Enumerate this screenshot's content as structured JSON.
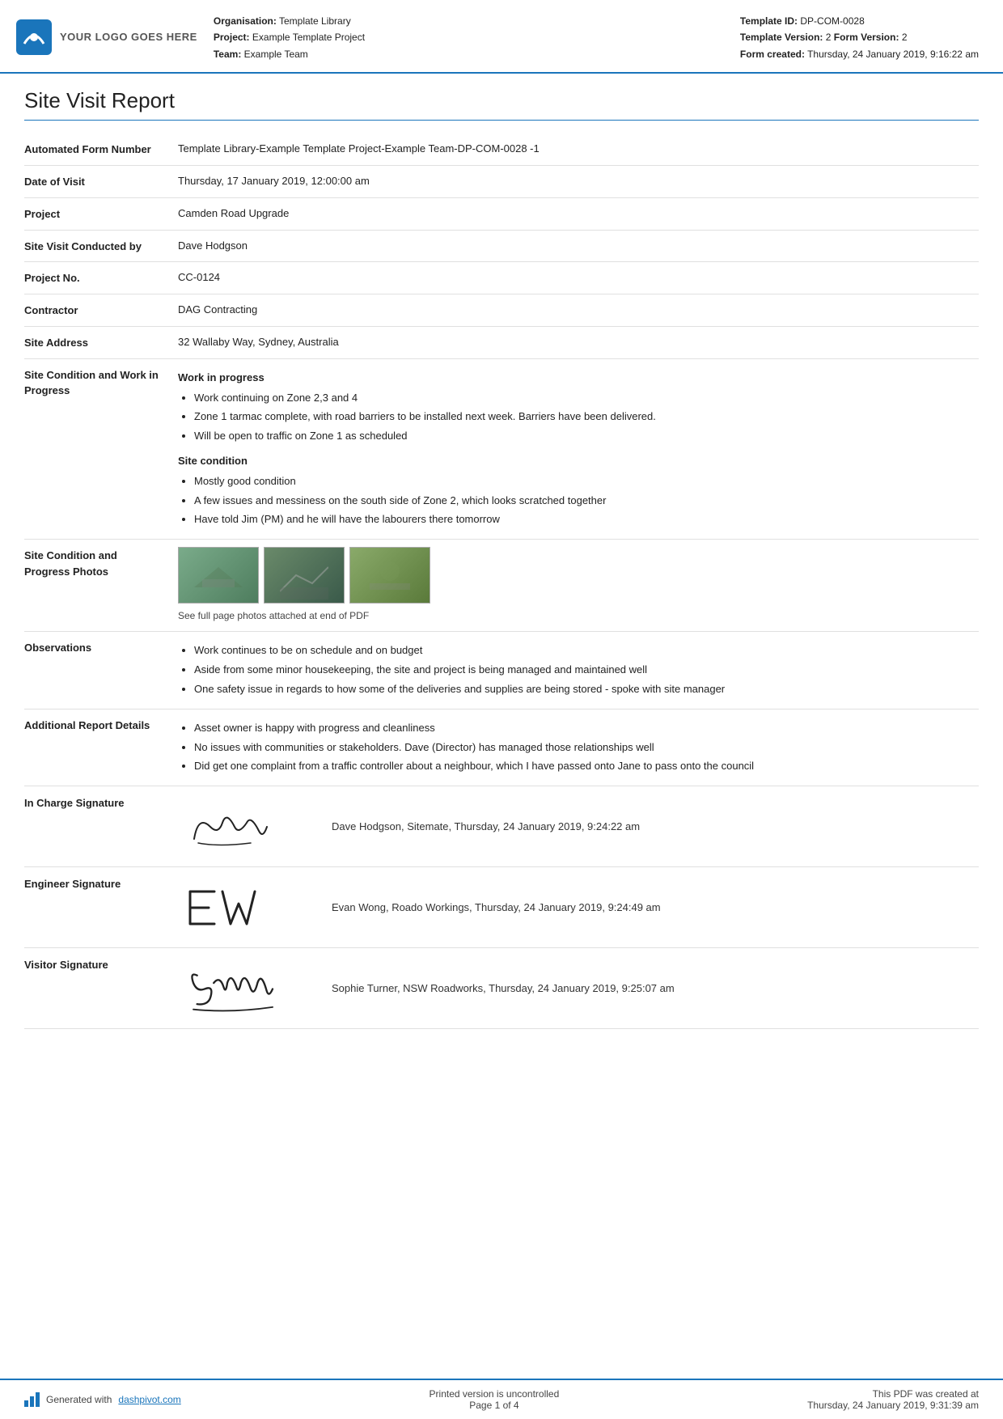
{
  "header": {
    "logo_text": "YOUR LOGO GOES HERE",
    "org_label": "Organisation:",
    "org_value": "Template Library",
    "project_label": "Project:",
    "project_value": "Example Template Project",
    "team_label": "Team:",
    "team_value": "Example Team",
    "template_id_label": "Template ID:",
    "template_id_value": "DP-COM-0028",
    "template_version_label": "Template Version:",
    "template_version_value": "2",
    "form_version_label": "Form Version:",
    "form_version_value": "2",
    "form_created_label": "Form created:",
    "form_created_value": "Thursday, 24 January 2019, 9:16:22 am"
  },
  "report": {
    "title": "Site Visit Report",
    "fields": {
      "automated_form_number_label": "Automated Form Number",
      "automated_form_number_value": "Template Library-Example Template Project-Example Team-DP-COM-0028   -1",
      "date_of_visit_label": "Date of Visit",
      "date_of_visit_value": "Thursday, 17 January 2019, 12:00:00 am",
      "project_label": "Project",
      "project_value": "Camden Road Upgrade",
      "site_visit_conducted_label": "Site Visit Conducted by",
      "site_visit_conducted_value": "Dave Hodgson",
      "project_no_label": "Project No.",
      "project_no_value": "CC-0124",
      "contractor_label": "Contractor",
      "contractor_value": "DAG Contracting",
      "site_address_label": "Site Address",
      "site_address_value": "32 Wallaby Way, Sydney, Australia",
      "site_condition_label": "Site Condition and Work in Progress",
      "site_condition_heading1": "Work in progress",
      "site_condition_bullet1": "Work continuing on Zone 2,3 and 4",
      "site_condition_bullet2": "Zone 1 tarmac complete, with road barriers to be installed next week. Barriers have been delivered.",
      "site_condition_bullet3": "Will be open to traffic on Zone 1 as scheduled",
      "site_condition_heading2": "Site condition",
      "site_condition_bullet4": "Mostly good condition",
      "site_condition_bullet5": "A few issues and messiness on the south side of Zone 2, which looks scratched together",
      "site_condition_bullet6": "Have told Jim (PM) and he will have the labourers there tomorrow",
      "photos_label": "Site Condition and Progress Photos",
      "photos_caption": "See full page photos attached at end of PDF",
      "observations_label": "Observations",
      "observations_bullet1": "Work continues to be on schedule and on budget",
      "observations_bullet2": "Aside from some minor housekeeping, the site and project is being managed and maintained well",
      "observations_bullet3": "One safety issue in regards to how some of the deliveries and supplies are being stored - spoke with site manager",
      "additional_label": "Additional Report Details",
      "additional_bullet1": "Asset owner is happy with progress and cleanliness",
      "additional_bullet2": "No issues with communities or stakeholders. Dave (Director) has managed those relationships well",
      "additional_bullet3": "Did get one complaint from a traffic controller about a neighbour, which I have passed onto Jane to pass onto the council"
    },
    "signatures": {
      "in_charge_label": "In Charge Signature",
      "in_charge_text": "Dave Hodgson, Sitemate, Thursday, 24 January 2019, 9:24:22 am",
      "engineer_label": "Engineer Signature",
      "engineer_text": "Evan Wong, Roado Workings, Thursday, 24 January 2019, 9:24:49 am",
      "visitor_label": "Visitor Signature",
      "visitor_text": "Sophie Turner, NSW Roadworks, Thursday, 24 January 2019, 9:25:07 am"
    }
  },
  "footer": {
    "generated_label": "Generated with ",
    "generated_link": "dashpivot.com",
    "printed_label": "Printed version is uncontrolled",
    "page_label": "Page 1 of 4",
    "pdf_created_label": "This PDF was created at",
    "pdf_created_value": "Thursday, 24 January 2019, 9:31:39 am"
  }
}
